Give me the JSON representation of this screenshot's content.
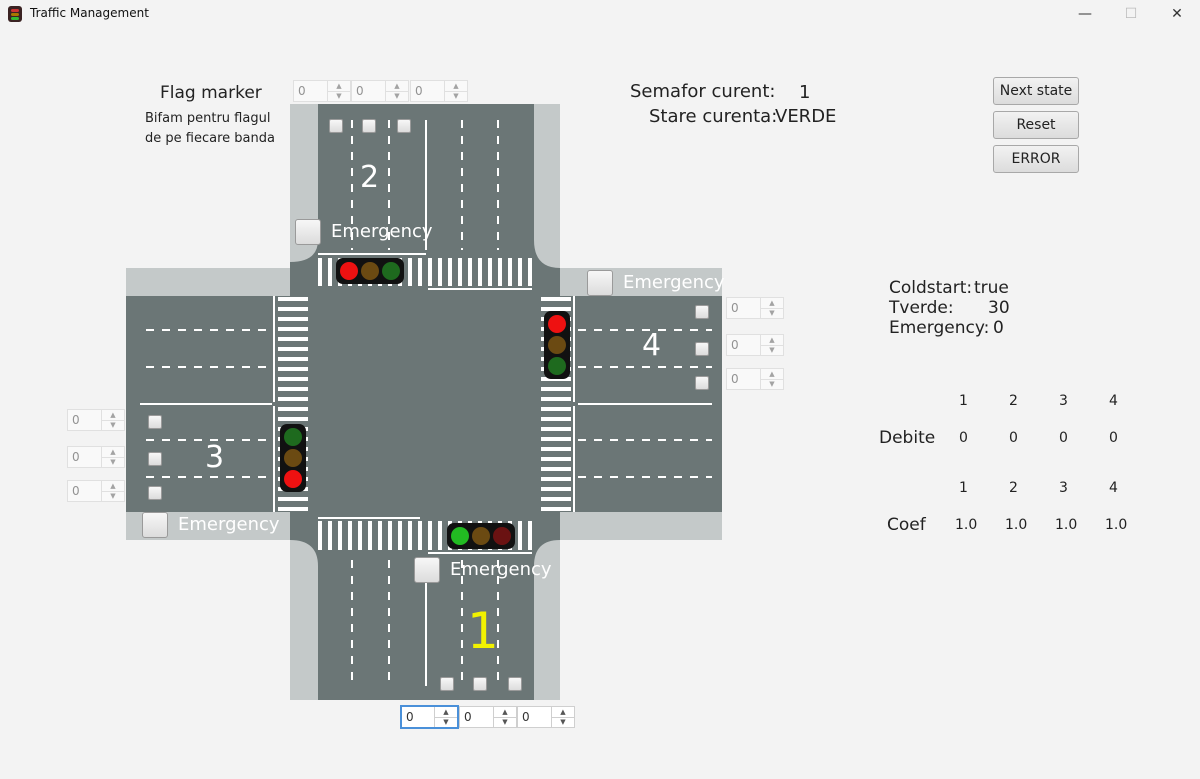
{
  "window": {
    "title": "Traffic Management",
    "minimize": "—",
    "maximize": "☐",
    "close": "✕"
  },
  "flag_marker": {
    "title": "Flag marker",
    "desc_line1": "Bifam pentru flagul",
    "desc_line2": "de pe fiecare banda"
  },
  "status": {
    "semafor_label": "Semafor curent:",
    "semafor_value": "1",
    "stare_label": "Stare curenta:",
    "stare_value": "VERDE"
  },
  "buttons": {
    "next_state": "Next state",
    "reset": "Reset",
    "error": "ERROR"
  },
  "info": {
    "coldstart_label": "Coldstart:",
    "coldstart_value": "true",
    "tverde_label": "Tverde:",
    "tverde_value": "30",
    "emergency_label": "Emergency:",
    "emergency_value": "0"
  },
  "debite": {
    "label": "Debite",
    "headers": [
      "1",
      "2",
      "3",
      "4"
    ],
    "values": [
      "0",
      "0",
      "0",
      "0"
    ]
  },
  "coef": {
    "label": "Coef",
    "headers": [
      "1",
      "2",
      "3",
      "4"
    ],
    "values": [
      "1.0",
      "1.0",
      "1.0",
      "1.0"
    ]
  },
  "roads": {
    "road1": {
      "number": "1",
      "emergency": "Emergency",
      "spinners": [
        "0",
        "0",
        "0"
      ],
      "light": "green"
    },
    "road2": {
      "number": "2",
      "emergency": "Emergency",
      "spinners": [
        "0",
        "0",
        "0"
      ],
      "light": "red"
    },
    "road3": {
      "number": "3",
      "emergency": "Emergency",
      "spinners": [
        "0",
        "0",
        "0"
      ],
      "light": "red"
    },
    "road4": {
      "number": "4",
      "emergency": "Emergency",
      "spinners": [
        "0",
        "0",
        "0"
      ],
      "light": "red"
    }
  },
  "colors": {
    "asphalt": "#6b7676",
    "sidewalk": "#c4c9c9",
    "red": "#ee1111",
    "amber_off": "#6b4a12",
    "green": "#22bb22",
    "green_off": "#1e6a1e",
    "red_off": "#6a1212",
    "road1_number": "#f2f200"
  },
  "icons": {
    "app": "traffic-light-icon"
  }
}
